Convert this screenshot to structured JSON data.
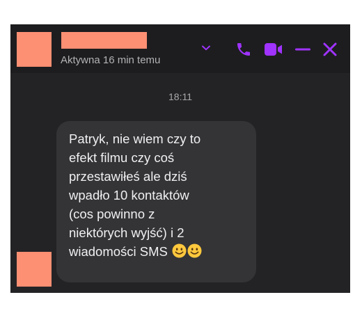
{
  "header": {
    "status": "Aktywna 16 min temu"
  },
  "conversation": {
    "timestamp": "18:11",
    "message": "Patryk, nie wiem czy to\nefekt filmu czy coś\nprzestawiłeś ale dziś\nwpadło 10 kontaktów\n(cos powinno z\nniektórych wyjść) i 2\nwiadomości SMS"
  },
  "colors": {
    "accent": "#a033ff",
    "window_background": "#232325",
    "header_background": "#1d1d1f",
    "bubble_background": "#343436",
    "redaction": "#fd8f73",
    "emoji_face": "#ffc83d"
  },
  "icons": {
    "expand": "chevron-down-icon",
    "call": "phone-icon",
    "video": "video-camera-icon",
    "minimize": "minimize-icon",
    "close": "close-icon",
    "emoji": "smiling-face-emoji"
  }
}
